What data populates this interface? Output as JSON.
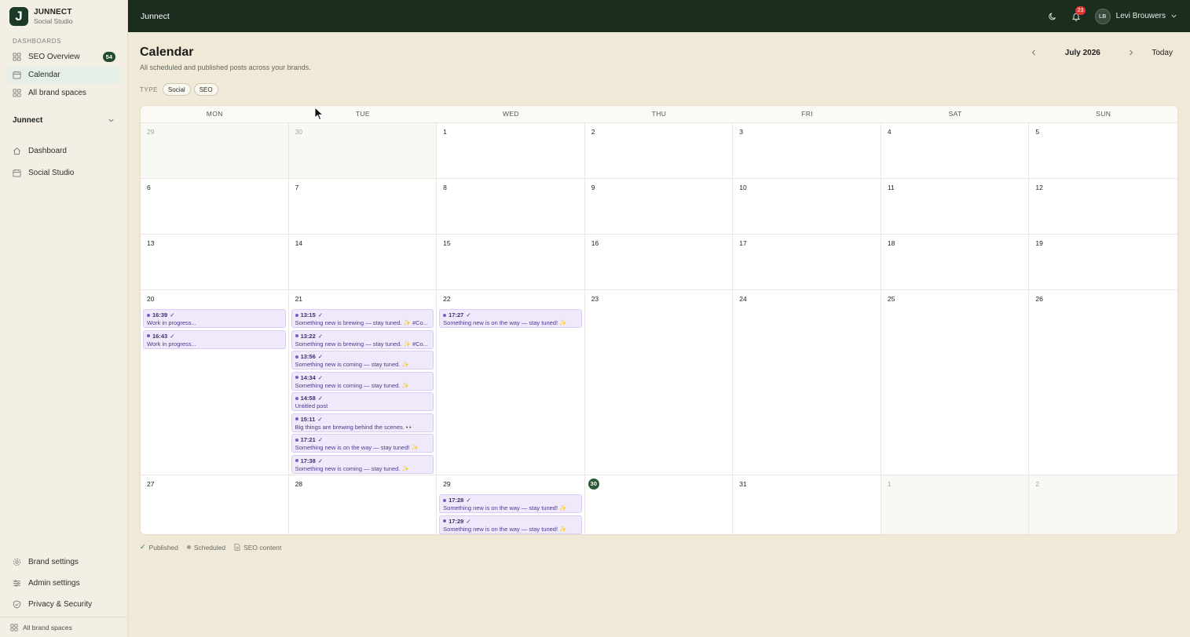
{
  "app": {
    "brand_name": "JUNNECT",
    "brand_sub": "Social Studio",
    "logo_letter": "J",
    "topbar_title": "Junnect"
  },
  "sidebar": {
    "section_label": "DASHBOARDS",
    "items": [
      {
        "label": "SEO Overview",
        "icon": "grid-icon",
        "badge": "54",
        "active": false
      },
      {
        "label": "Calendar",
        "icon": "calendar-icon",
        "badge": "",
        "active": true
      },
      {
        "label": "All brand spaces",
        "icon": "grid-icon",
        "badge": "",
        "active": false
      }
    ],
    "workspace": "Junnect",
    "workspace_items": [
      {
        "label": "Dashboard",
        "icon": "home-icon"
      },
      {
        "label": "Social Studio",
        "icon": "calendar-icon"
      }
    ],
    "bottom_items": [
      {
        "label": "Brand settings",
        "icon": "gear-icon"
      },
      {
        "label": "Admin settings",
        "icon": "sliders-icon"
      },
      {
        "label": "Privacy & Security",
        "icon": "shield-icon"
      }
    ],
    "footer_label": "All brand spaces"
  },
  "topbar": {
    "notification_count": "23",
    "user_initials": "LB",
    "user_name": "Levi Brouwers"
  },
  "page": {
    "title": "Calendar",
    "subtitle": "All scheduled and published posts across your brands.",
    "month_label": "July 2026",
    "today_label": "Today",
    "filter_label": "TYPE",
    "filters": [
      "Social",
      "SEO"
    ]
  },
  "calendar": {
    "weekdays": [
      "MON",
      "TUE",
      "WED",
      "THU",
      "FRI",
      "SAT",
      "SUN"
    ],
    "today": 30,
    "days": [
      {
        "n": "29",
        "out": true
      },
      {
        "n": "30",
        "out": true
      },
      {
        "n": "1"
      },
      {
        "n": "2"
      },
      {
        "n": "3"
      },
      {
        "n": "4"
      },
      {
        "n": "5"
      },
      {
        "n": "6"
      },
      {
        "n": "7"
      },
      {
        "n": "8"
      },
      {
        "n": "9"
      },
      {
        "n": "10"
      },
      {
        "n": "11"
      },
      {
        "n": "12"
      },
      {
        "n": "13"
      },
      {
        "n": "14"
      },
      {
        "n": "15"
      },
      {
        "n": "16"
      },
      {
        "n": "17"
      },
      {
        "n": "18"
      },
      {
        "n": "19"
      },
      {
        "n": "20",
        "events": [
          {
            "time": "16:39",
            "text": "Work in progress..."
          },
          {
            "time": "16:43",
            "text": "Work in progress..."
          }
        ]
      },
      {
        "n": "21",
        "events": [
          {
            "time": "13:15",
            "text": "Something new is brewing — stay tuned. ✨ #Co..."
          },
          {
            "time": "13:22",
            "text": "Something new is brewing — stay tuned. ✨ #Co..."
          },
          {
            "time": "13:56",
            "text": "Something new is coming — stay tuned. ✨"
          },
          {
            "time": "14:34",
            "text": "Something new is coming — stay tuned. ✨"
          },
          {
            "time": "14:58",
            "text": "Untitled post"
          },
          {
            "time": "15:11",
            "text": "Big things are brewing behind the scenes. 👀"
          },
          {
            "time": "17:21",
            "text": "Something new is on the way — stay tuned! ✨"
          },
          {
            "time": "17:38",
            "text": "Something new is coming — stay tuned. ✨"
          }
        ]
      },
      {
        "n": "22",
        "events": [
          {
            "time": "17:27",
            "text": "Something new is on the way — stay tuned! ✨"
          }
        ]
      },
      {
        "n": "23"
      },
      {
        "n": "24"
      },
      {
        "n": "25"
      },
      {
        "n": "26"
      },
      {
        "n": "27"
      },
      {
        "n": "28"
      },
      {
        "n": "29",
        "events": [
          {
            "time": "17:28",
            "text": "Something new is on the way — stay tuned! ✨"
          },
          {
            "time": "17:29",
            "text": "Something new is on the way — stay tuned! ✨"
          }
        ]
      },
      {
        "n": "30",
        "today": true
      },
      {
        "n": "31"
      },
      {
        "n": "1",
        "out": true
      },
      {
        "n": "2",
        "out": true
      }
    ]
  },
  "legend": {
    "published": "Published",
    "scheduled": "Scheduled",
    "seo": "SEO content"
  },
  "colors": {
    "sidebar_bg": "#f4efe4",
    "topbar_bg": "#1a2d1f",
    "main_bg": "#f1e9d7",
    "event_bg": "#efe9fb",
    "accent_green": "#2b5a36",
    "badge_red": "#e5322d"
  }
}
